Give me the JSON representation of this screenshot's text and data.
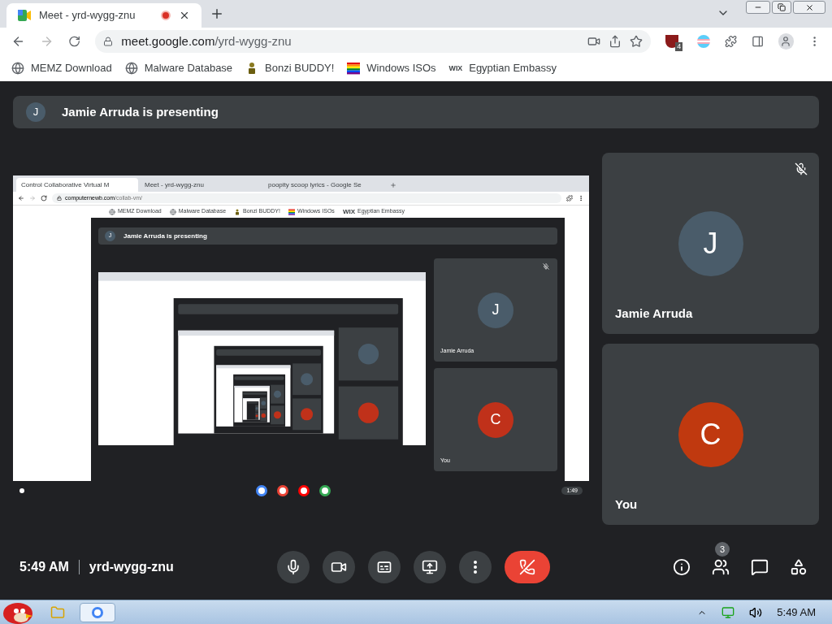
{
  "browser": {
    "tabs": [
      {
        "title": "Meet - yrd-wygg-znu",
        "selected": true,
        "recording": true
      }
    ],
    "url_host": "meet.google.com",
    "url_path": "/yrd-wygg-znu",
    "extension_badge": "4",
    "bookmarks": [
      {
        "label": "MEMZ Download",
        "kind": "globe"
      },
      {
        "label": "Malware Database",
        "kind": "globe"
      },
      {
        "label": "Bonzi BUDDY!",
        "kind": "bonzi"
      },
      {
        "label": "Windows ISOs",
        "kind": "rainbow"
      },
      {
        "label": "Egyptian Embassy",
        "kind": "wix",
        "favicon_text": "WIX"
      }
    ]
  },
  "meet": {
    "banner": {
      "avatar": "J",
      "text": "Jamie Arruda is presenting"
    },
    "shared_screen": {
      "tabs": [
        {
          "title": "Control Collaborative Virtual M",
          "selected": true
        },
        {
          "title": "Meet - yrd-wygg-znu",
          "selected": false
        },
        {
          "title": "poopity scoop lyrics - Google Se",
          "selected": false
        }
      ],
      "url_host": "computernewb.com",
      "url_path": "/collab-vm/",
      "bookmarks": [
        {
          "label": "MEMZ Download",
          "kind": "globe"
        },
        {
          "label": "Malware Database",
          "kind": "globe"
        },
        {
          "label": "Bonzi BUDDY!",
          "kind": "bonzi"
        },
        {
          "label": "Windows ISOs",
          "kind": "rainbow"
        },
        {
          "label": "Egyptian Embassy",
          "kind": "wix",
          "favicon_text": "WIX"
        }
      ],
      "banner": {
        "avatar": "J",
        "text": "Jamie Arruda is presenting"
      },
      "participants": [
        {
          "initial": "J",
          "name": "Jamie Arruda",
          "color": "#4a5c6a",
          "muted": true
        },
        {
          "initial": "C",
          "name": "You",
          "color": "#c0311a",
          "muted": false
        }
      ],
      "shelf_time": "1:49"
    },
    "participants": [
      {
        "initial": "J",
        "name": "Jamie Arruda",
        "color": "#4a5c6a",
        "muted": true
      },
      {
        "initial": "C",
        "name": "You",
        "color": "#c0390f",
        "muted": false
      }
    ],
    "footer": {
      "time": "5:49 AM",
      "meeting_code": "yrd-wygg-znu",
      "people_count": "3",
      "controls": [
        {
          "kind": "mic"
        },
        {
          "kind": "camera"
        },
        {
          "kind": "captions"
        },
        {
          "kind": "present"
        },
        {
          "kind": "more"
        },
        {
          "kind": "leave"
        }
      ],
      "side_controls": [
        {
          "kind": "info"
        },
        {
          "kind": "people"
        },
        {
          "kind": "chat"
        },
        {
          "kind": "activities"
        }
      ]
    }
  },
  "taskbar": {
    "clock": "5:49 AM"
  }
}
